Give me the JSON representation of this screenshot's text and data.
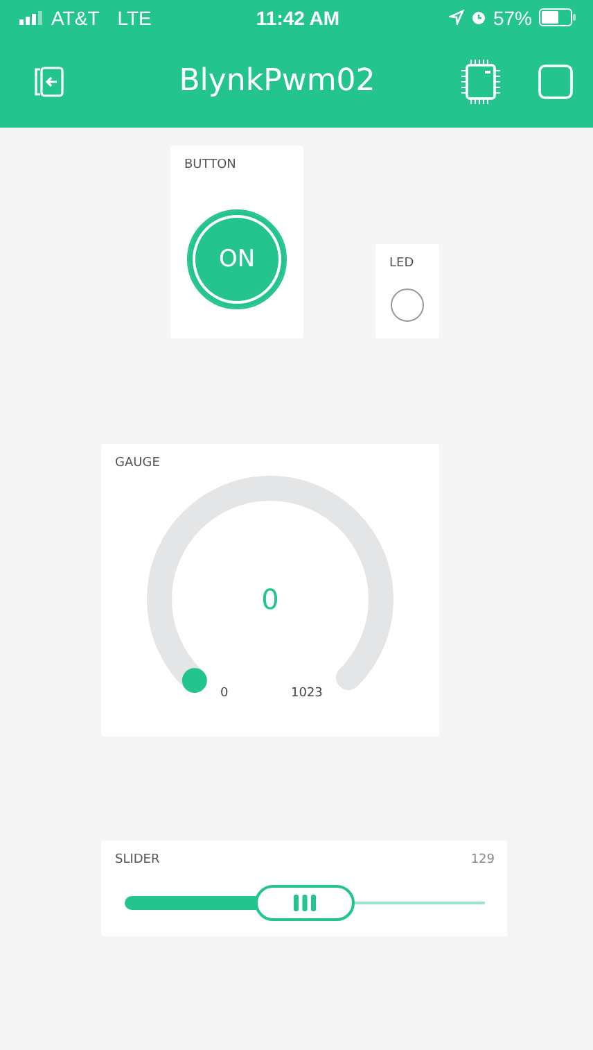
{
  "status_bar": {
    "carrier": "AT&T",
    "network": "LTE",
    "time": "11:42 AM",
    "battery": "57%"
  },
  "header": {
    "title": "BlynkPwm02"
  },
  "widgets": [
    {
      "kind": "button",
      "label": "BUTTON",
      "text": "ON",
      "on": true
    },
    {
      "kind": "led",
      "label": "LED",
      "on": false
    },
    {
      "kind": "gauge",
      "label": "GAUGE",
      "value": "0",
      "min": "0",
      "max": "1023"
    },
    {
      "kind": "slider",
      "label": "SLIDER",
      "value": "129",
      "level": 0.5
    }
  ]
}
